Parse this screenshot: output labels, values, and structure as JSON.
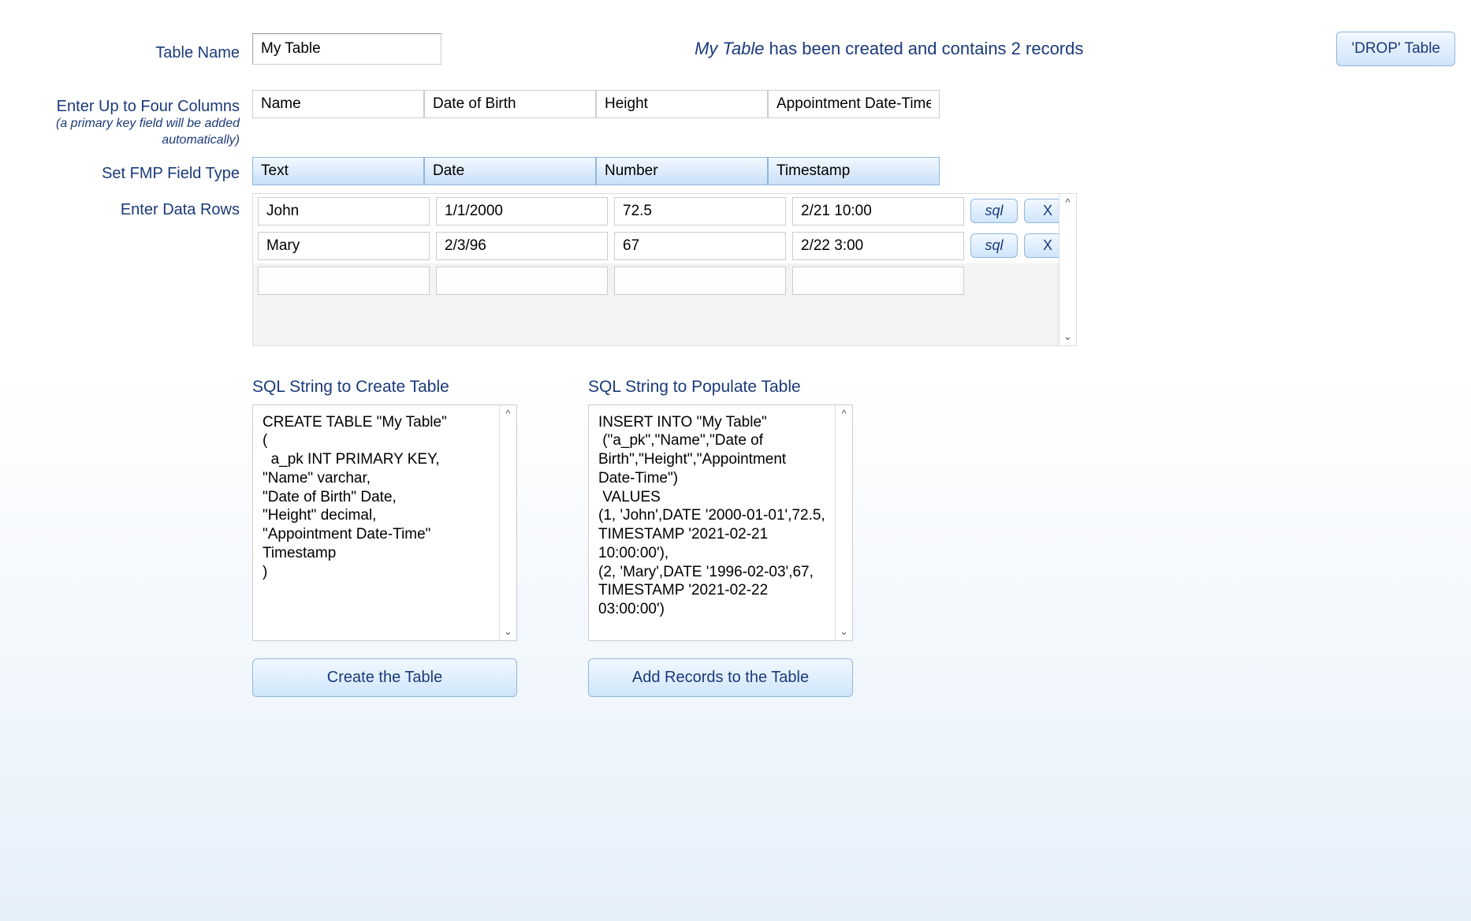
{
  "labels": {
    "table_name": "Table Name",
    "enter_columns": "Enter Up to Four Columns",
    "enter_columns_sub": "(a primary key field will be added automatically)",
    "field_type": "Set  FMP Field Type",
    "data_rows": "Enter Data Rows",
    "sql_create_title": "SQL String to Create Table",
    "sql_populate_title": "SQL String to Populate Table"
  },
  "header": {
    "table_name_value": "My Table",
    "status_em": "My Table",
    "status_rest": " has been created and contains 2 records",
    "drop_btn": "'DROP' Table"
  },
  "columns": {
    "c0": "Name",
    "c1": "Date of Birth",
    "c2": "Height",
    "c3": "Appointment Date-Time"
  },
  "types": {
    "t0": "Text",
    "t1": "Date",
    "t2": "Number",
    "t3": "Timestamp"
  },
  "rows": [
    {
      "c0": "John",
      "c1": "1/1/2000",
      "c2": "72.5",
      "c3": "2/21 10:00"
    },
    {
      "c0": "Mary",
      "c1": "2/3/96",
      "c2": "67",
      "c3": "2/22 3:00"
    },
    {
      "c0": "",
      "c1": "",
      "c2": "",
      "c3": ""
    }
  ],
  "row_buttons": {
    "sql": "sql",
    "x": "X"
  },
  "sql": {
    "create": "CREATE TABLE \"My Table\"\n(\n  a_pk INT PRIMARY KEY,\n\"Name\" varchar,\n\"Date of Birth\" Date,\n\"Height\" decimal,\n\"Appointment Date-Time\" Timestamp\n)",
    "populate": "INSERT INTO \"My Table\"\n (\"a_pk\",\"Name\",\"Date of Birth\",\"Height\",\"Appointment Date-Time\")\n VALUES \n(1, 'John',DATE '2000-01-01',72.5, TIMESTAMP '2021-02-21 10:00:00'),\n(2, 'Mary',DATE '1996-02-03',67, TIMESTAMP '2021-02-22 03:00:00')",
    "create_btn": "Create the Table",
    "populate_btn": "Add Records to the Table"
  }
}
